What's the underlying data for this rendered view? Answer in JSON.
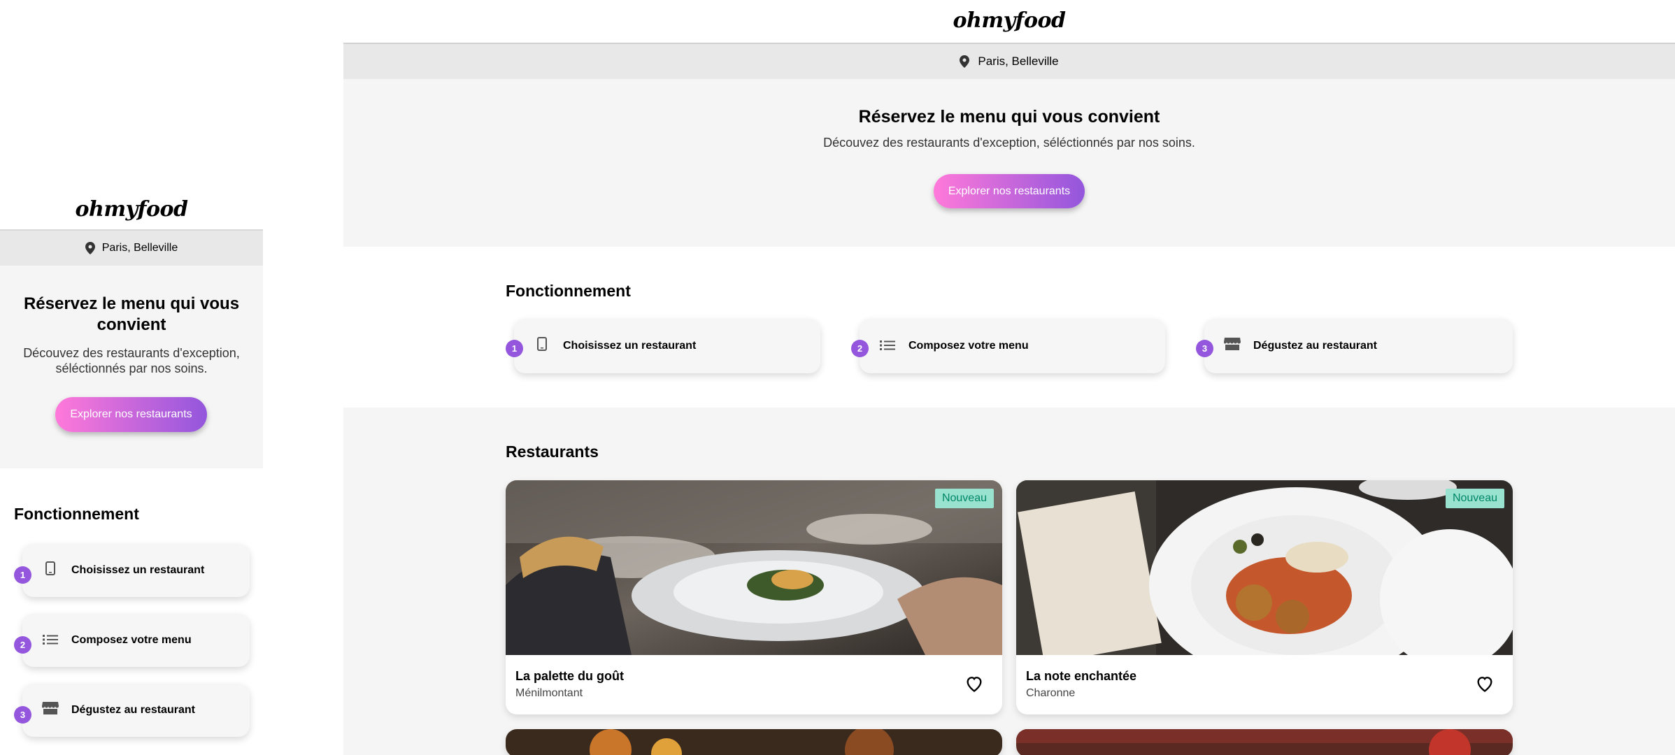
{
  "brand": {
    "logo": "ohmyfood"
  },
  "location": {
    "label": "Paris, Belleville",
    "icon": "map-pin-icon"
  },
  "hero": {
    "title": "Réservez le menu qui vous convient",
    "subtitle": "Découvez des restaurants d'exception, séléctionnés par nos soins.",
    "cta_label": "Explorer nos restaurants"
  },
  "how_it_works": {
    "title": "Fonctionnement",
    "steps": [
      {
        "number": "1",
        "label": "Choisissez un restaurant",
        "icon": "mobile-phone-icon"
      },
      {
        "number": "2",
        "label": "Composez votre menu",
        "icon": "list-icon"
      },
      {
        "number": "3",
        "label": "Dégustez au restaurant",
        "icon": "store-icon"
      }
    ]
  },
  "restaurants": {
    "title": "Restaurants",
    "items": [
      {
        "name": "La palette du goût",
        "area": "Ménilmontant",
        "badge": "Nouveau"
      },
      {
        "name": "La note enchantée",
        "area": "Charonne",
        "badge": "Nouveau"
      }
    ]
  },
  "colors": {
    "accent_start": "#ff79da",
    "accent_end": "#9356dc",
    "badge_bg": "#99e2d0",
    "badge_text": "#008766"
  }
}
